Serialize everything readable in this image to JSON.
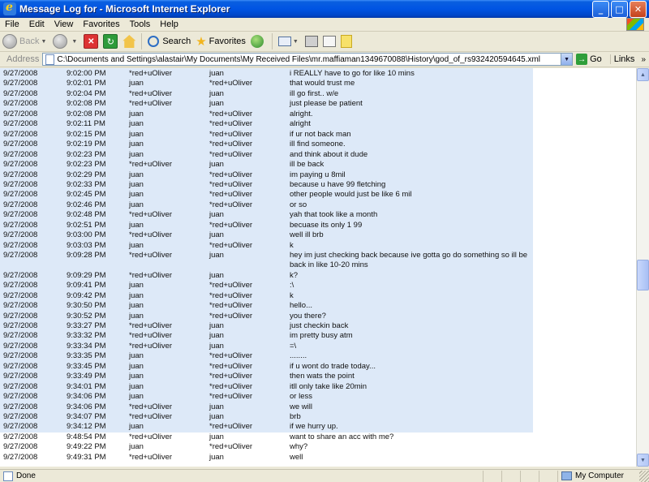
{
  "window": {
    "title": "Message Log for - Microsoft Internet Explorer"
  },
  "menu": [
    "File",
    "Edit",
    "View",
    "Favorites",
    "Tools",
    "Help"
  ],
  "toolbar": {
    "back": "Back",
    "search": "Search",
    "favorites": "Favorites"
  },
  "address": {
    "label": "Address",
    "url": "C:\\Documents and Settings\\alastair\\My Documents\\My Received Files\\mr.maffiaman1349670088\\History\\god_of_rs932420594645.xml",
    "go": "Go",
    "links": "Links"
  },
  "log_rows": [
    {
      "date": "9/27/2008",
      "time": "9:02:00 PM",
      "from": "*red+uOliver",
      "to": "juan",
      "msg": "i REALLY have to go for like 10 mins"
    },
    {
      "date": "9/27/2008",
      "time": "9:02:01 PM",
      "from": "juan",
      "to": "*red+uOliver",
      "msg": "that would trust me"
    },
    {
      "date": "9/27/2008",
      "time": "9:02:04 PM",
      "from": "*red+uOliver",
      "to": "juan",
      "msg": "ill go first.. w/e"
    },
    {
      "date": "9/27/2008",
      "time": "9:02:08 PM",
      "from": "*red+uOliver",
      "to": "juan",
      "msg": "just please be patient"
    },
    {
      "date": "9/27/2008",
      "time": "9:02:08 PM",
      "from": "juan",
      "to": "*red+uOliver",
      "msg": "alright."
    },
    {
      "date": "9/27/2008",
      "time": "9:02:11 PM",
      "from": "juan",
      "to": "*red+uOliver",
      "msg": "alright"
    },
    {
      "date": "9/27/2008",
      "time": "9:02:15 PM",
      "from": "juan",
      "to": "*red+uOliver",
      "msg": "if ur not back man"
    },
    {
      "date": "9/27/2008",
      "time": "9:02:19 PM",
      "from": "juan",
      "to": "*red+uOliver",
      "msg": "ill find someone."
    },
    {
      "date": "9/27/2008",
      "time": "9:02:23 PM",
      "from": "juan",
      "to": "*red+uOliver",
      "msg": "and think about it dude"
    },
    {
      "date": "9/27/2008",
      "time": "9:02:23 PM",
      "from": "*red+uOliver",
      "to": "juan",
      "msg": "ill be back"
    },
    {
      "date": "9/27/2008",
      "time": "9:02:29 PM",
      "from": "juan",
      "to": "*red+uOliver",
      "msg": "im paying u 8mil"
    },
    {
      "date": "9/27/2008",
      "time": "9:02:33 PM",
      "from": "juan",
      "to": "*red+uOliver",
      "msg": "because u have 99 fletching"
    },
    {
      "date": "9/27/2008",
      "time": "9:02:45 PM",
      "from": "juan",
      "to": "*red+uOliver",
      "msg": "other people would just be like 6 mil"
    },
    {
      "date": "9/27/2008",
      "time": "9:02:46 PM",
      "from": "juan",
      "to": "*red+uOliver",
      "msg": "or so"
    },
    {
      "date": "9/27/2008",
      "time": "9:02:48 PM",
      "from": "*red+uOliver",
      "to": "juan",
      "msg": "yah that took like a month"
    },
    {
      "date": "9/27/2008",
      "time": "9:02:51 PM",
      "from": "juan",
      "to": "*red+uOliver",
      "msg": "becuase its only 1 99"
    },
    {
      "date": "9/27/2008",
      "time": "9:03:00 PM",
      "from": "*red+uOliver",
      "to": "juan",
      "msg": "well ill brb"
    },
    {
      "date": "9/27/2008",
      "time": "9:03:03 PM",
      "from": "juan",
      "to": "*red+uOliver",
      "msg": "k"
    },
    {
      "date": "9/27/2008",
      "time": "9:09:28 PM",
      "from": "*red+uOliver",
      "to": "juan",
      "msg": "hey im just checking back because ive gotta go do something so ill be back in like 10-20 mins"
    },
    {
      "date": "9/27/2008",
      "time": "9:09:29 PM",
      "from": "*red+uOliver",
      "to": "juan",
      "msg": "k?"
    },
    {
      "date": "9/27/2008",
      "time": "9:09:41 PM",
      "from": "juan",
      "to": "*red+uOliver",
      "msg": ":\\"
    },
    {
      "date": "9/27/2008",
      "time": "9:09:42 PM",
      "from": "juan",
      "to": "*red+uOliver",
      "msg": "k"
    },
    {
      "date": "9/27/2008",
      "time": "9:30:50 PM",
      "from": "juan",
      "to": "*red+uOliver",
      "msg": "hello..."
    },
    {
      "date": "9/27/2008",
      "time": "9:30:52 PM",
      "from": "juan",
      "to": "*red+uOliver",
      "msg": "you there?"
    },
    {
      "date": "9/27/2008",
      "time": "9:33:27 PM",
      "from": "*red+uOliver",
      "to": "juan",
      "msg": "just checkin back"
    },
    {
      "date": "9/27/2008",
      "time": "9:33:32 PM",
      "from": "*red+uOliver",
      "to": "juan",
      "msg": "im pretty busy atm"
    },
    {
      "date": "9/27/2008",
      "time": "9:33:34 PM",
      "from": "*red+uOliver",
      "to": "juan",
      "msg": "=\\"
    },
    {
      "date": "9/27/2008",
      "time": "9:33:35 PM",
      "from": "juan",
      "to": "*red+uOliver",
      "msg": "........"
    },
    {
      "date": "9/27/2008",
      "time": "9:33:45 PM",
      "from": "juan",
      "to": "*red+uOliver",
      "msg": "if u wont do trade today..."
    },
    {
      "date": "9/27/2008",
      "time": "9:33:49 PM",
      "from": "juan",
      "to": "*red+uOliver",
      "msg": "then wats the point"
    },
    {
      "date": "9/27/2008",
      "time": "9:34:01 PM",
      "from": "juan",
      "to": "*red+uOliver",
      "msg": "itll only take like 20min"
    },
    {
      "date": "9/27/2008",
      "time": "9:34:06 PM",
      "from": "juan",
      "to": "*red+uOliver",
      "msg": "or less"
    },
    {
      "date": "9/27/2008",
      "time": "9:34:06 PM",
      "from": "*red+uOliver",
      "to": "juan",
      "msg": "we will"
    },
    {
      "date": "9/27/2008",
      "time": "9:34:07 PM",
      "from": "*red+uOliver",
      "to": "juan",
      "msg": "brb"
    },
    {
      "date": "9/27/2008",
      "time": "9:34:12 PM",
      "from": "juan",
      "to": "*red+uOliver",
      "msg": "if we hurry up."
    },
    {
      "date": "9/27/2008",
      "time": "9:48:54 PM",
      "from": "*red+uOliver",
      "to": "juan",
      "msg": "want to share an acc with me?"
    },
    {
      "date": "9/27/2008",
      "time": "9:49:22 PM",
      "from": "juan",
      "to": "*red+uOliver",
      "msg": "why?"
    },
    {
      "date": "9/27/2008",
      "time": "9:49:31 PM",
      "from": "*red+uOliver",
      "to": "juan",
      "msg": "well"
    }
  ],
  "status": {
    "text": "Done",
    "zone": "My Computer"
  }
}
